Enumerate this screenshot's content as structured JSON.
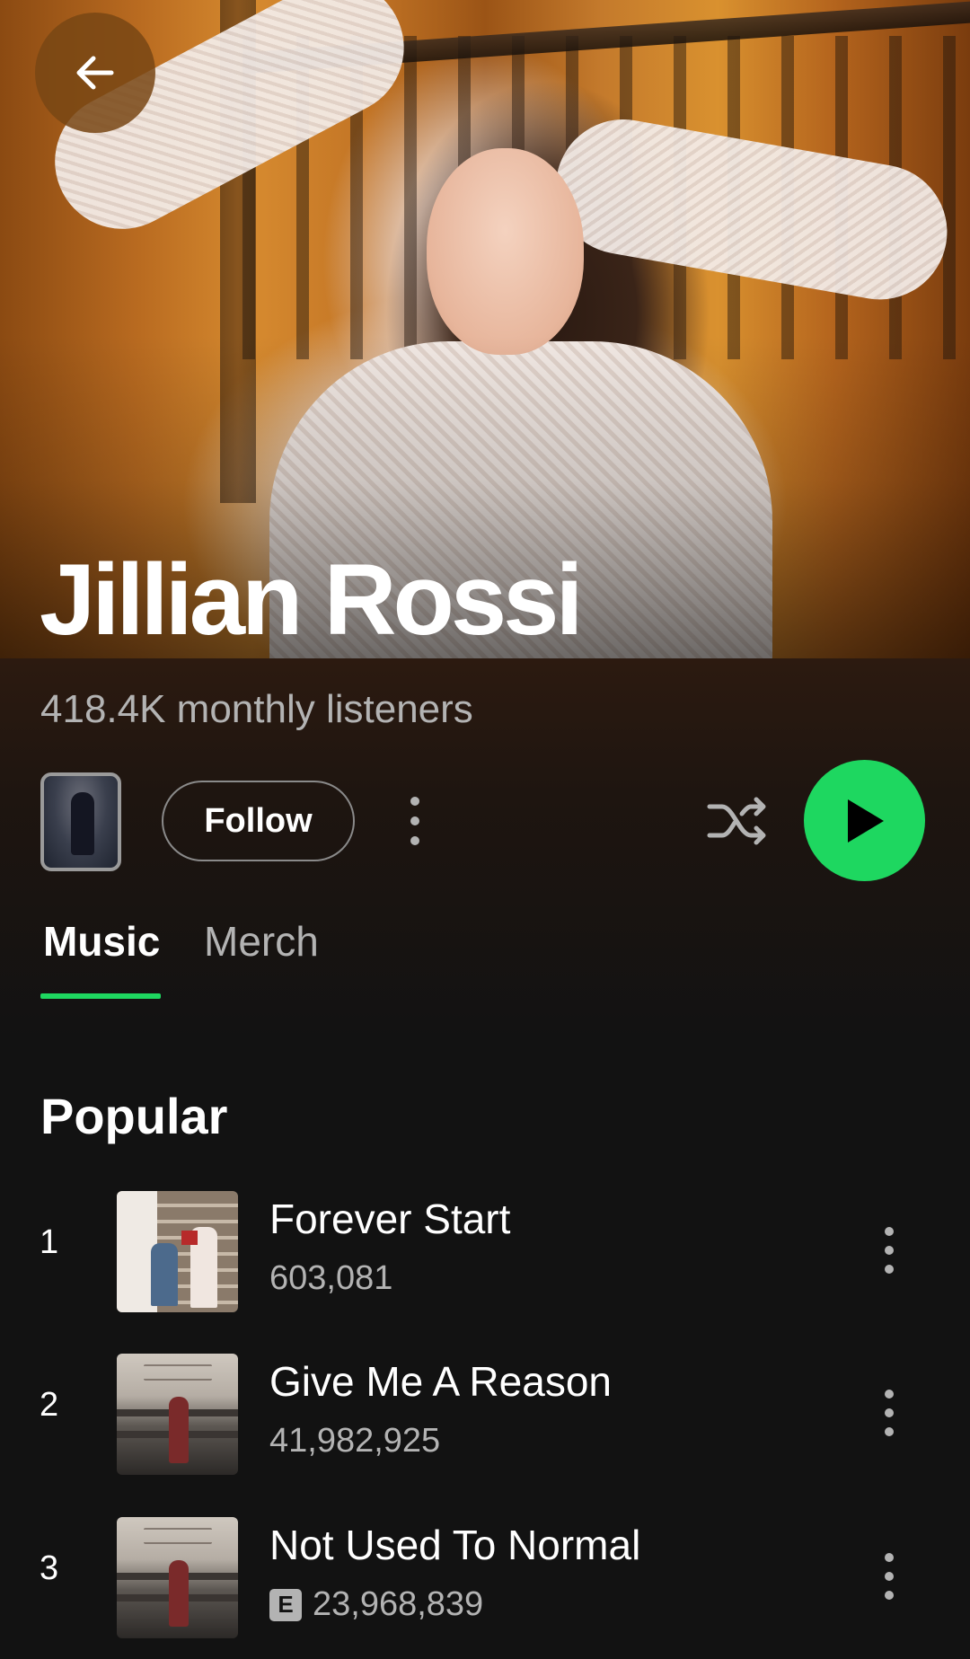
{
  "artist": {
    "name": "Jillian Rossi",
    "listeners": "418.4K monthly listeners"
  },
  "controls": {
    "follow_label": "Follow"
  },
  "tabs": [
    {
      "label": "Music",
      "active": true
    },
    {
      "label": "Merch",
      "active": false
    }
  ],
  "popular": {
    "title": "Popular",
    "tracks": [
      {
        "rank": "1",
        "title": "Forever Start",
        "plays": "603,081",
        "explicit": false
      },
      {
        "rank": "2",
        "title": "Give Me A Reason",
        "plays": "41,982,925",
        "explicit": false
      },
      {
        "rank": "3",
        "title": "Not Used To Normal",
        "plays": "23,968,839",
        "explicit": true,
        "explicit_label": "E"
      }
    ]
  },
  "colors": {
    "accent": "#1ed760",
    "background": "#121212",
    "secondary_text": "#b3b3b3"
  },
  "icons": {
    "back": "arrow-left-icon",
    "more": "more-vertical-icon",
    "shuffle": "shuffle-icon",
    "play": "play-icon"
  }
}
